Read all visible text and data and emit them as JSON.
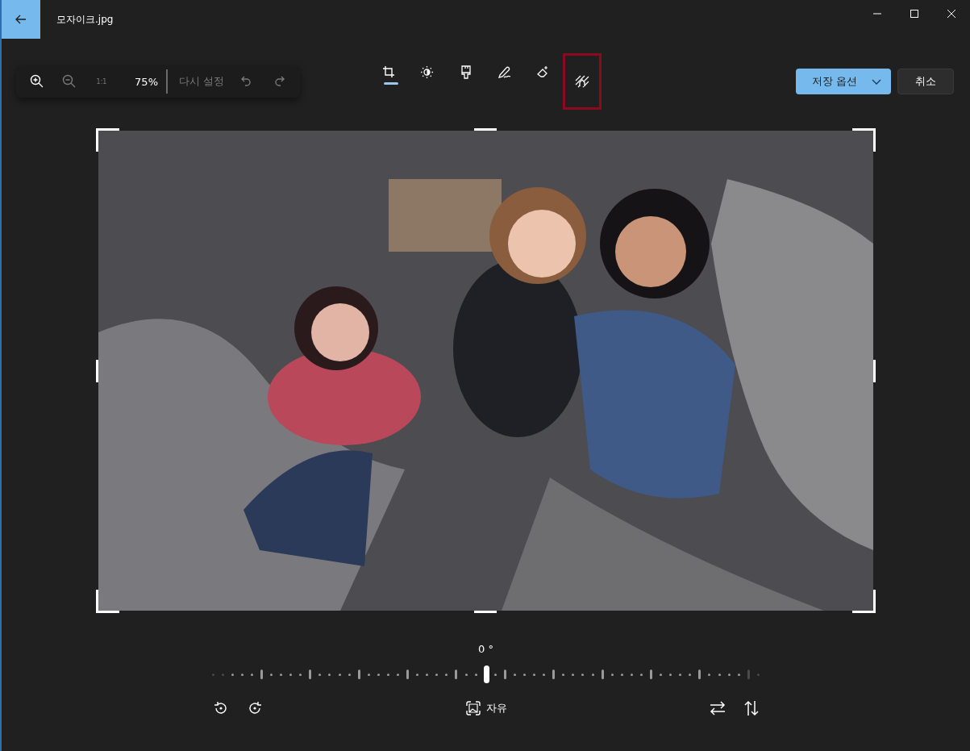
{
  "window": {
    "title": "모자이크.jpg"
  },
  "zoom_panel": {
    "zoom_in": {
      "disabled": false
    },
    "zoom_out": {
      "disabled": true
    },
    "actual_size": {
      "label": "1:1",
      "disabled": true
    },
    "zoom_value": "75%",
    "reset": {
      "label": "다시 설정",
      "disabled": true
    },
    "undo": {
      "disabled": true
    },
    "redo": {
      "disabled": true
    }
  },
  "tools": [
    {
      "kind": "crop",
      "selected": true,
      "highlighted": false
    },
    {
      "kind": "adjust",
      "selected": false,
      "highlighted": false
    },
    {
      "kind": "filter",
      "selected": false,
      "highlighted": false
    },
    {
      "kind": "markup",
      "selected": false,
      "highlighted": false
    },
    {
      "kind": "retouch",
      "selected": false,
      "highlighted": false
    },
    {
      "kind": "mosaic",
      "selected": false,
      "highlighted": true
    }
  ],
  "actions": {
    "save_options": "저장 옵션",
    "cancel": "취소"
  },
  "straighten": {
    "reading": "0 °",
    "level": 0.5
  },
  "bottom_bar": {
    "aspect": "자유"
  }
}
